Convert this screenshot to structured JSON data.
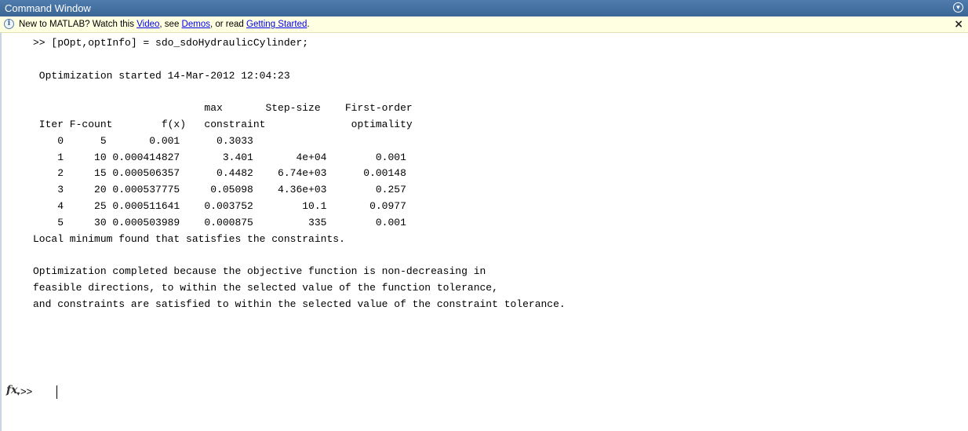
{
  "window": {
    "title": "Command Window",
    "menu_icon": "circle-chevron-down-icon"
  },
  "infobar": {
    "icon": "info-icon",
    "icon_glyph": "i",
    "prefix": "New to MATLAB? Watch this ",
    "link_video": "Video",
    "sep1": ", see ",
    "link_demos": "Demos",
    "sep2": ", or read ",
    "link_getting_started": "Getting Started",
    "suffix": ".",
    "close_glyph": "×"
  },
  "console": {
    "lines": [
      ">> [pOpt,optInfo] = sdo_sdoHydraulicCylinder;",
      "",
      " Optimization started 14-Mar-2012 12:04:23",
      "",
      "                            max       Step-size    First-order",
      " Iter F-count        f(x)   constraint              optimality",
      "    0      5       0.001      0.3033",
      "    1     10 0.000414827       3.401       4e+04        0.001",
      "    2     15 0.000506357      0.4482    6.74e+03      0.00148",
      "    3     20 0.000537775     0.05098    4.36e+03        0.257",
      "    4     25 0.000511641    0.003752        10.1       0.0977",
      "    5     30 0.000503989    0.000875         335        0.001",
      "Local minimum found that satisfies the constraints.",
      "",
      "Optimization completed because the objective function is non-decreasing in",
      "feasible directions, to within the selected value of the function tolerance,",
      "and constraints are satisfied to within the selected value of the constraint tolerance."
    ],
    "fx_label": "fx",
    "fx_sub": "▾",
    "prompt": ">>"
  },
  "colors": {
    "titlebar": "#3b6696",
    "infobar_bg": "#ffffe1",
    "link": "#0000ee"
  }
}
